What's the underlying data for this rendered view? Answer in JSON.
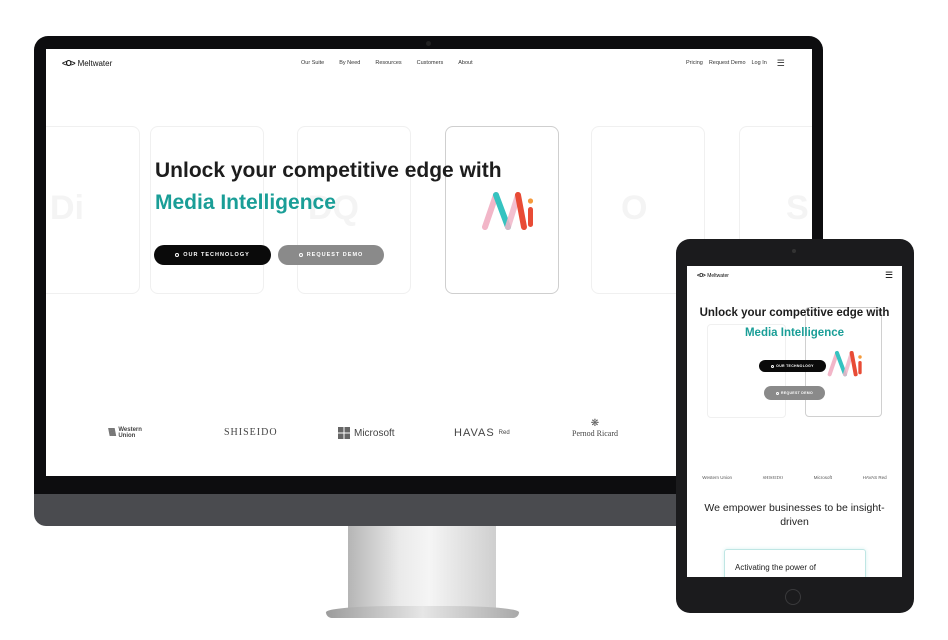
{
  "desktop": {
    "logo_text": "Meltwater",
    "nav_links": [
      "Our Suite",
      "By Need",
      "Resources",
      "Customers",
      "About"
    ],
    "nav_right": [
      "Pricing",
      "Request Demo",
      "Log In"
    ],
    "hero_title": "Unlock your competitive edge with",
    "hero_subtitle": "Media Intelligence",
    "btn_technology": "OUR TECHNOLOGY",
    "btn_demo": "REQUEST DEMO",
    "logos": {
      "western_union": "Western\nUnion",
      "shiseido": "SHISEIDO",
      "microsoft": "Microsoft",
      "havas": "HAVAS",
      "havas_suffix": "Red",
      "pernod": "Pernod Ricard"
    }
  },
  "tablet": {
    "logo_text": "Meltwater",
    "hero_title": "Unlock your competitive edge with",
    "hero_subtitle": "Media Intelligence",
    "btn_technology": "OUR TECHNOLOGY",
    "btn_demo": "REQUEST DEMO",
    "logos": [
      "Western Union",
      "SHISEIDO",
      "Microsoft",
      "HAVAS Red"
    ],
    "empower_text": "We empower businesses to be insight-driven",
    "card_text": "Activating the power of"
  },
  "colors": {
    "accent_teal": "#1a9e97",
    "dark_button": "#0a0a0a",
    "grey_button": "#8a8a8a",
    "mi_pink": "#f2b6c8",
    "mi_teal": "#35c3c0",
    "mi_red": "#e84b35",
    "mi_orange": "#f59a3b"
  }
}
